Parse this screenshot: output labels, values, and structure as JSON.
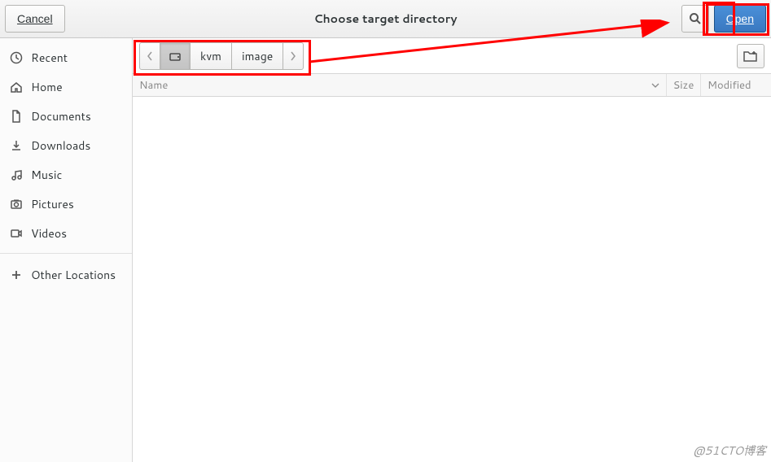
{
  "title": "Choose target directory",
  "cancel_label": "Cancel",
  "open_label": "Open",
  "sidebar": {
    "items": [
      {
        "icon": "clock-icon",
        "label": "Recent"
      },
      {
        "icon": "home-icon",
        "label": "Home"
      },
      {
        "icon": "document-icon",
        "label": "Documents"
      },
      {
        "icon": "download-icon",
        "label": "Downloads"
      },
      {
        "icon": "music-icon",
        "label": "Music"
      },
      {
        "icon": "camera-icon",
        "label": "Pictures"
      },
      {
        "icon": "video-icon",
        "label": "Videos"
      }
    ],
    "other": {
      "icon": "plus-icon",
      "label": "Other Locations"
    }
  },
  "breadcrumb": {
    "items": [
      {
        "label": "kvm"
      },
      {
        "label": "image"
      }
    ]
  },
  "columns": {
    "name": "Name",
    "size": "Size",
    "modified": "Modified"
  },
  "watermark": "@51CTO博客"
}
